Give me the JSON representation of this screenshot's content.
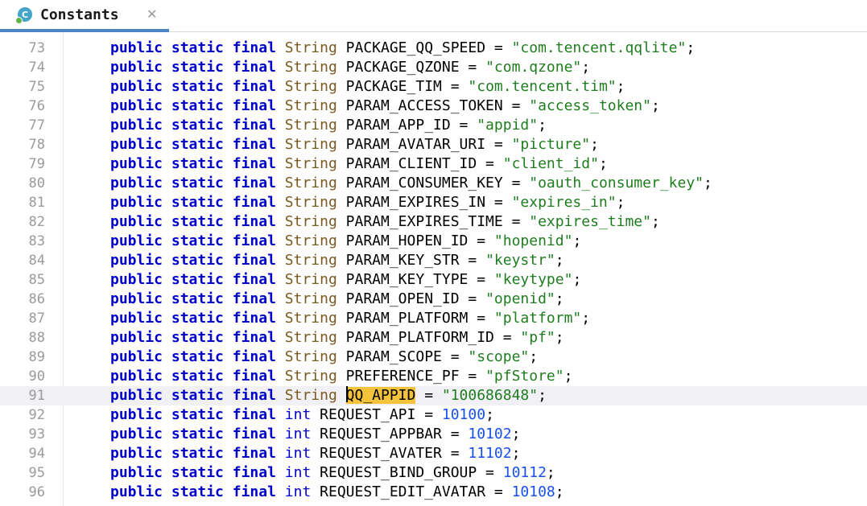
{
  "tab": {
    "title": "Constants",
    "icon": "class-icon",
    "icon_letter": "C",
    "close_glyph": "✕"
  },
  "keywords": {
    "public": "public",
    "static": "static",
    "final": "final"
  },
  "lines": [
    {
      "ln": "73",
      "type": "String",
      "kind": "ref",
      "name": "PACKAGE_QQ_SPEED",
      "value": "\"com.tencent.qqlite\""
    },
    {
      "ln": "74",
      "type": "String",
      "kind": "ref",
      "name": "PACKAGE_QZONE",
      "value": "\"com.qzone\""
    },
    {
      "ln": "75",
      "type": "String",
      "kind": "ref",
      "name": "PACKAGE_TIM",
      "value": "\"com.tencent.tim\""
    },
    {
      "ln": "76",
      "type": "String",
      "kind": "ref",
      "name": "PARAM_ACCESS_TOKEN",
      "value": "\"access_token\""
    },
    {
      "ln": "77",
      "type": "String",
      "kind": "ref",
      "name": "PARAM_APP_ID",
      "value": "\"appid\""
    },
    {
      "ln": "78",
      "type": "String",
      "kind": "ref",
      "name": "PARAM_AVATAR_URI",
      "value": "\"picture\""
    },
    {
      "ln": "79",
      "type": "String",
      "kind": "ref",
      "name": "PARAM_CLIENT_ID",
      "value": "\"client_id\""
    },
    {
      "ln": "80",
      "type": "String",
      "kind": "ref",
      "name": "PARAM_CONSUMER_KEY",
      "value": "\"oauth_consumer_key\""
    },
    {
      "ln": "81",
      "type": "String",
      "kind": "ref",
      "name": "PARAM_EXPIRES_IN",
      "value": "\"expires_in\""
    },
    {
      "ln": "82",
      "type": "String",
      "kind": "ref",
      "name": "PARAM_EXPIRES_TIME",
      "value": "\"expires_time\""
    },
    {
      "ln": "83",
      "type": "String",
      "kind": "ref",
      "name": "PARAM_HOPEN_ID",
      "value": "\"hopenid\""
    },
    {
      "ln": "84",
      "type": "String",
      "kind": "ref",
      "name": "PARAM_KEY_STR",
      "value": "\"keystr\""
    },
    {
      "ln": "85",
      "type": "String",
      "kind": "ref",
      "name": "PARAM_KEY_TYPE",
      "value": "\"keytype\""
    },
    {
      "ln": "86",
      "type": "String",
      "kind": "ref",
      "name": "PARAM_OPEN_ID",
      "value": "\"openid\""
    },
    {
      "ln": "87",
      "type": "String",
      "kind": "ref",
      "name": "PARAM_PLATFORM",
      "value": "\"platform\""
    },
    {
      "ln": "88",
      "type": "String",
      "kind": "ref",
      "name": "PARAM_PLATFORM_ID",
      "value": "\"pf\""
    },
    {
      "ln": "89",
      "type": "String",
      "kind": "ref",
      "name": "PARAM_SCOPE",
      "value": "\"scope\""
    },
    {
      "ln": "90",
      "type": "String",
      "kind": "ref",
      "name": "PREFERENCE_PF",
      "value": "\"pfStore\""
    },
    {
      "ln": "91",
      "type": "String",
      "kind": "ref",
      "name": "QQ_APPID",
      "value": "\"100686848\"",
      "current": true,
      "highlighted": true
    },
    {
      "ln": "92",
      "type": "int",
      "kind": "prim",
      "name": "REQUEST_API",
      "value": "10100"
    },
    {
      "ln": "93",
      "type": "int",
      "kind": "prim",
      "name": "REQUEST_APPBAR",
      "value": "10102"
    },
    {
      "ln": "94",
      "type": "int",
      "kind": "prim",
      "name": "REQUEST_AVATER",
      "value": "11102"
    },
    {
      "ln": "95",
      "type": "int",
      "kind": "prim",
      "name": "REQUEST_BIND_GROUP",
      "value": "10112"
    },
    {
      "ln": "96",
      "type": "int",
      "kind": "prim",
      "name": "REQUEST_EDIT_AVATAR",
      "value": "10108"
    }
  ],
  "colors": {
    "keyword": "#0000c8",
    "string_type": "#7a5a1e",
    "string_literal": "#1e7d1e",
    "number_literal": "#1750eb",
    "highlight": "#f5c33b",
    "tab_underline": "#4a86c8"
  }
}
